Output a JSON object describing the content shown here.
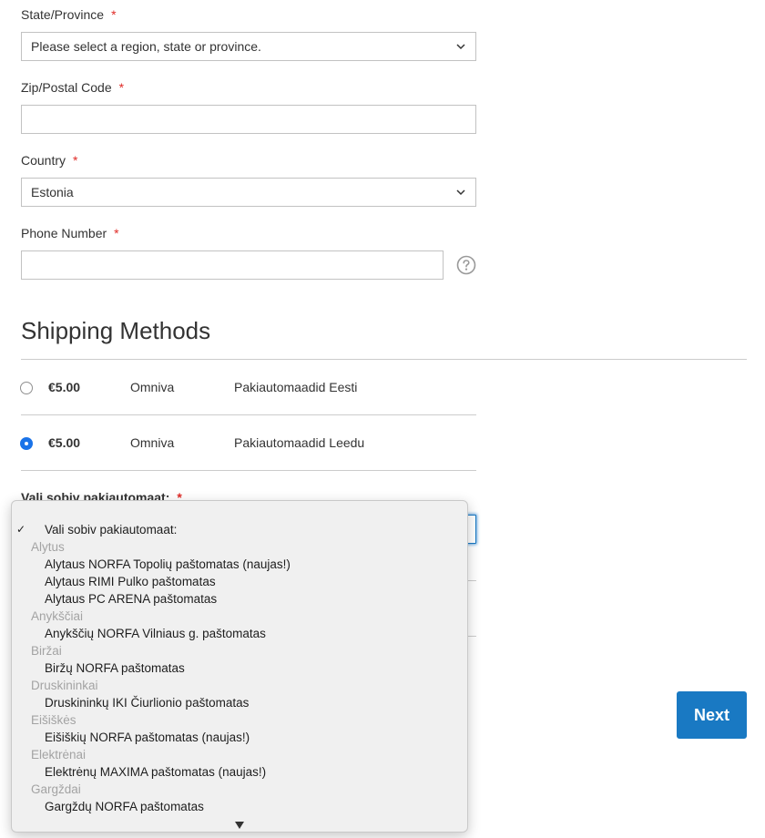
{
  "form": {
    "state": {
      "label": "State/Province",
      "required_mark": "*",
      "value": "Please select a region, state or province."
    },
    "zip": {
      "label": "Zip/Postal Code",
      "required_mark": "*",
      "value": ""
    },
    "country": {
      "label": "Country",
      "required_mark": "*",
      "value": "Estonia"
    },
    "phone": {
      "label": "Phone Number",
      "required_mark": "*",
      "value": "",
      "help_icon": "question-circle-icon"
    }
  },
  "shipping": {
    "title": "Shipping Methods",
    "methods": [
      {
        "price": "€5.00",
        "carrier": "Omniva",
        "method": "Pakiautomaadid Eesti",
        "selected": false
      },
      {
        "price": "€5.00",
        "carrier": "Omniva",
        "method": "Pakiautomaadid Leedu",
        "selected": true
      }
    ],
    "terminal": {
      "label": "Vali sobiv pakiautomaat:",
      "required_mark": "*"
    }
  },
  "dropdown": {
    "selected_check": "✓",
    "items": [
      {
        "type": "option",
        "text": "Vali sobiv pakiautomaat:",
        "selected": true
      },
      {
        "type": "group",
        "text": "Alytus"
      },
      {
        "type": "option",
        "text": "Alytaus NORFA Topolių paštomatas (naujas!)"
      },
      {
        "type": "option",
        "text": "Alytaus RIMI Pulko paštomatas"
      },
      {
        "type": "option",
        "text": "Alytaus PC ARENA paštomatas"
      },
      {
        "type": "group",
        "text": "Anykščiai"
      },
      {
        "type": "option",
        "text": "Anykščių NORFA Vilniaus g. paštomatas"
      },
      {
        "type": "group",
        "text": "Biržai"
      },
      {
        "type": "option",
        "text": "Biržų NORFA paštomatas"
      },
      {
        "type": "group",
        "text": "Druskininkai"
      },
      {
        "type": "option",
        "text": "Druskininkų IKI Čiurlionio paštomatas"
      },
      {
        "type": "group",
        "text": "Eišiškės"
      },
      {
        "type": "option",
        "text": "Eišiškių NORFA paštomatas (naujas!)"
      },
      {
        "type": "group",
        "text": "Elektrėnai"
      },
      {
        "type": "option",
        "text": "Elektrėnų MAXIMA paštomatas (naujas!)"
      },
      {
        "type": "group",
        "text": "Gargždai"
      },
      {
        "type": "option",
        "text": "Gargždų NORFA paštomatas"
      }
    ]
  },
  "actions": {
    "next_label": "Next"
  },
  "colors": {
    "accent": "#1979c3",
    "required": "#e02b27",
    "radio_checked": "#1a73e8"
  }
}
